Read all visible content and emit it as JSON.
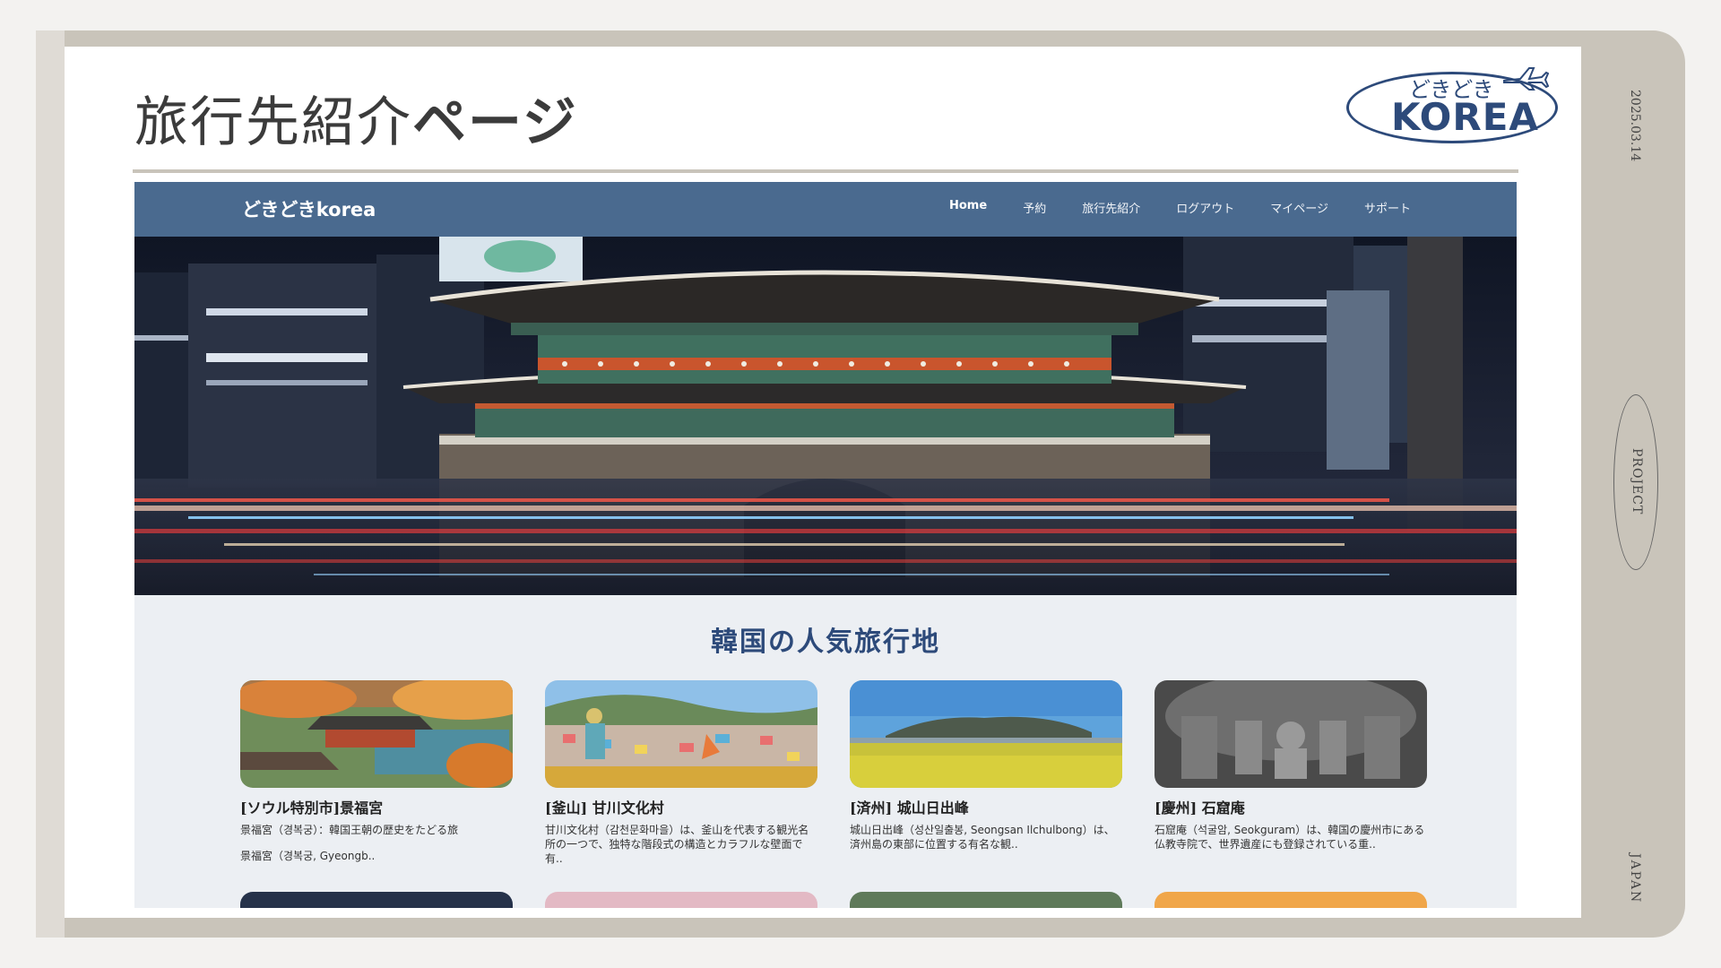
{
  "slide": {
    "title_light": "旅行先紹介",
    "title_bold": "ページ",
    "date": "2025.03.14",
    "project_label": "PROJECT",
    "country_label": "JAPAN",
    "logo": {
      "sub": "どきどき",
      "main": "KOREA"
    }
  },
  "site": {
    "brand": "どきどきkorea",
    "menu": [
      {
        "label": "Home"
      },
      {
        "label": "予約"
      },
      {
        "label": "旅行先紹介"
      },
      {
        "label": "ログアウト"
      },
      {
        "label": "マイページ"
      },
      {
        "label": "サポート"
      }
    ],
    "section_title": "韓国の人気旅行地",
    "cards": [
      {
        "title": "[ソウル特別市]景福宮",
        "desc": "景福宮（경복궁）：韓国王朝の歴史をたどる旅",
        "extra": "景福宮（경복궁, Gyeongb.."
      },
      {
        "title": "[釜山] 甘川文化村",
        "desc": "甘川文化村（감천문화마을）は、釜山を代表する観光名所の一つで、独特な階段式の構造とカラフルな壁面で有..",
        "extra": ""
      },
      {
        "title": "[済州] 城山日出峰",
        "desc": "城山日出峰（성산일출봉, Seongsan Ilchulbong）は、済州島の東部に位置する有名な観..",
        "extra": ""
      },
      {
        "title": "[慶州] 石窟庵",
        "desc": "石窟庵（석굴암, Seokguram）は、韓国の慶州市にある仏教寺院で、世界遺産にも登録されている重..",
        "extra": ""
      }
    ]
  },
  "colors": {
    "nav": "#4a6a8f",
    "accent": "#2d4a7a",
    "frame": "#c9c4ba"
  }
}
